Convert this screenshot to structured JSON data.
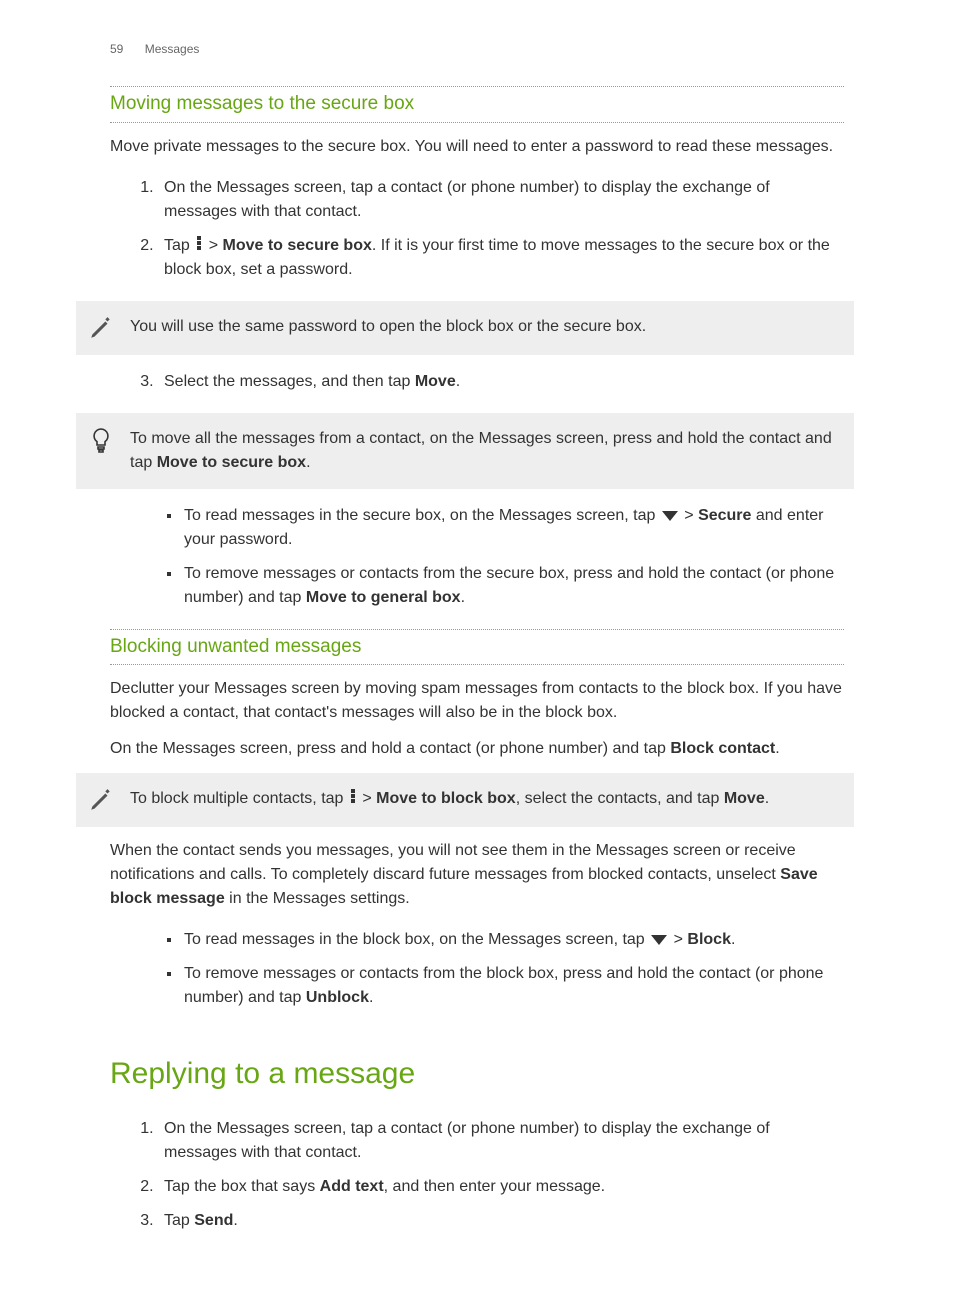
{
  "header": {
    "page": "59",
    "section": "Messages"
  },
  "s1": {
    "title": "Moving messages to the secure box",
    "intro": "Move private messages to the secure box. You will need to enter a password to read these messages.",
    "step1": "On the Messages screen, tap a contact (or phone number) to display the exchange of messages with that contact.",
    "step2a": "Tap ",
    "step2b": " > ",
    "step2c": "Move to secure box",
    "step2d": ". If it is your first time to move messages to the secure box or the block box, set a password.",
    "note1": "You will use the same password to open the block box or the secure box.",
    "step3a": "Select the messages, and then tap ",
    "step3b": "Move",
    "step3c": ".",
    "tip1a": "To move all the messages from a contact, on the Messages screen, press and hold the contact and tap ",
    "tip1b": "Move to secure box",
    "tip1c": ".",
    "b1a": "To read messages in the secure box, on the Messages screen, tap ",
    "b1b": " > ",
    "b1c": "Secure",
    "b1d": " and enter your password.",
    "b2a": "To remove messages or contacts from the secure box, press and hold the contact (or phone number) and tap ",
    "b2b": "Move to general box",
    "b2c": "."
  },
  "s2": {
    "title": "Blocking unwanted messages",
    "intro": "Declutter your Messages screen by moving spam messages from contacts to the block box. If you have blocked a contact, that contact's messages will also be in the block box.",
    "p2a": "On the Messages screen, press and hold a contact (or phone number) and tap ",
    "p2b": "Block contact",
    "p2c": ".",
    "note1a": "To block multiple contacts, tap ",
    "note1b": " > ",
    "note1c": "Move to block box",
    "note1d": ", select the contacts, and tap ",
    "note1e": "Move",
    "note1f": ".",
    "p3a": "When the contact sends you messages, you will not see them in the Messages screen or receive notifications and calls. To completely discard future messages from blocked contacts, unselect ",
    "p3b": "Save block message",
    "p3c": " in the Messages settings.",
    "b1a": "To read messages in the block box, on the Messages screen, tap ",
    "b1b": " > ",
    "b1c": "Block",
    "b1d": ".",
    "b2a": "To remove messages or contacts from the block box, press and hold the contact (or phone number) and tap ",
    "b2b": "Unblock",
    "b2c": "."
  },
  "s3": {
    "title": "Replying to a message",
    "step1": "On the Messages screen, tap a contact (or phone number) to display the exchange of messages with that contact.",
    "step2a": "Tap the box that says ",
    "step2b": "Add text",
    "step2c": ", and then enter your message.",
    "step3a": "Tap ",
    "step3b": "Send",
    "step3c": "."
  }
}
